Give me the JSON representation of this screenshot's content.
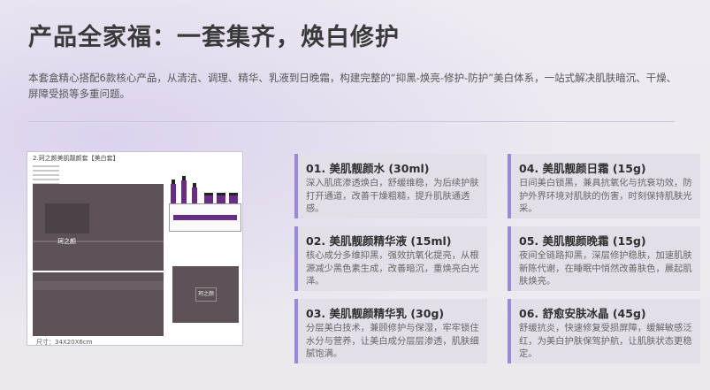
{
  "header": {
    "title": "产品全家福：一套集齐，焕白修护",
    "intro": "本套盒精心搭配6款核心产品，从清洁、调理、精华、乳液到日晚霜，构建完整的“抑黑-焕亮-修护-防护”美白体系，一站式解决肌肤暗沉、干燥、屏障受损等多重问题。"
  },
  "product_image": {
    "caption": "2.珂之颜美肌靓颜套【美白套】",
    "logo_text": "珂之颜",
    "size_label": "尺寸：34X20X6cm"
  },
  "products": [
    {
      "title": "01. 美肌靓颜水 (30ml)",
      "desc": "深入肌底渗透焕白，舒缓维稳，为后续护肤打开通道，改善干燥粗糙，提升肌肤通透感。"
    },
    {
      "title": "02. 美肌靓颜精华液 (15ml)",
      "desc": "核心成分多维抑黑，强效抗氧化提亮，从根源减少黑色素生成，改善暗沉，重焕亮白光泽。"
    },
    {
      "title": "03. 美肌靓颜精华乳 (30g)",
      "desc": "分层美白技术，兼顾修护与保湿，牢牢锁住水分与营养，让美白成分层层渗透，肌肤细腻饱满。"
    },
    {
      "title": "04. 美肌靓颜日霜 (15g)",
      "desc": "日间美白锁黑，兼具抗氧化与抗衰功效，防护外界环境对肌肤的伤害，时刻保持肌肤光采。"
    },
    {
      "title": "05. 美肌靓颜晚霜 (15g)",
      "desc": "夜间全链路抑黑，深层修护稳肤，加速肌肤新陈代谢，在睡眠中悄然改善肤色，晨起肌肤焕亮。"
    },
    {
      "title": "06. 舒愈安肤冰晶 (45g)",
      "desc": "舒缓抗炎，快速修复受损屏障，缓解敏感泛红，为美白护肤保驾护航，让肌肤状态更稳定。"
    }
  ],
  "colors": {
    "accent": "#9b88d6",
    "card_bg": "#e3dfe8",
    "packaging": "#5d5257",
    "bottle": "#6a2d84"
  }
}
